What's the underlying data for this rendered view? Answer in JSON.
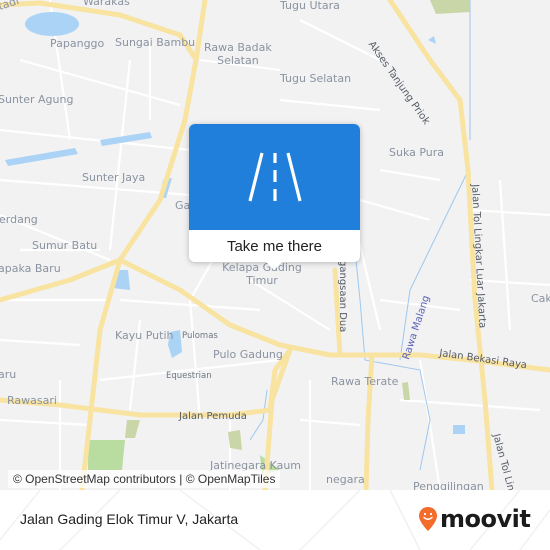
{
  "map": {
    "labels": [
      {
        "id": "warakas",
        "text": "Warakas"
      },
      {
        "id": "papanggo",
        "text": "Papanggo"
      },
      {
        "id": "sungai-bambu",
        "text": "Sungai Bambu"
      },
      {
        "id": "rawa-badak-selatan-1",
        "text": "Rawa Badak"
      },
      {
        "id": "rawa-badak-selatan-2",
        "text": "Selatan"
      },
      {
        "id": "tugu-utara",
        "text": "Tugu Utara"
      },
      {
        "id": "tugu-selatan",
        "text": "Tugu Selatan"
      },
      {
        "id": "sunter-agung",
        "text": "Sunter Agung"
      },
      {
        "id": "sunter-jaya",
        "text": "Sunter Jaya"
      },
      {
        "id": "suka-pura",
        "text": "Suka Pura"
      },
      {
        "id": "serdang",
        "text": "erdang"
      },
      {
        "id": "sumur-batu",
        "text": "Sumur Batu"
      },
      {
        "id": "cempaka-baru",
        "text": "apaka Baru"
      },
      {
        "id": "gading-partial",
        "text": "Ga"
      },
      {
        "id": "kelapa-gading-timur-1",
        "text": "Kelapa Gading"
      },
      {
        "id": "kelapa-gading-timur-2",
        "text": "Timur"
      },
      {
        "id": "kayu-putih",
        "text": "Kayu Putih"
      },
      {
        "id": "pulomas",
        "text": "Pulomas"
      },
      {
        "id": "pulo-gadung",
        "text": "Pulo Gadung"
      },
      {
        "id": "equestrian",
        "text": "Equestrian"
      },
      {
        "id": "rawasari",
        "text": "Rawasari"
      },
      {
        "id": "baru-partial",
        "text": "aru"
      },
      {
        "id": "rawa-terate",
        "text": "Rawa Terate"
      },
      {
        "id": "jatinegara-kaum",
        "text": "Jatinegara Kaum"
      },
      {
        "id": "jatinegara",
        "text": "negara"
      },
      {
        "id": "penggilingan",
        "text": "Penggilingan"
      },
      {
        "id": "cakung-partial",
        "text": "Cak"
      },
      {
        "id": "sunter-partial",
        "text": "tadi"
      }
    ],
    "roads": {
      "akses_tanjung_priok": "Akses Tanjung Priok",
      "jalan_tol_lingkar_luar": "Jalan Tol Lingkar Luar Jakarta",
      "jalan_tol_lingkar_luar_2": "Jalan Tol Lin",
      "jalan_bekasi_raya": "Jalan Bekasi Raya",
      "jalan_pemuda": "Jalan Pemuda",
      "pegangsaan_dua": "gangsaan Dua",
      "rawa_malang": "Rawa Malang"
    },
    "colors": {
      "background": "#f2f2f3",
      "major_road": "#f8e3a1",
      "minor_road": "#ffffff",
      "water": "#aad3f5",
      "park": "#c9d7a8"
    }
  },
  "popup": {
    "icon": "road-icon",
    "cta_label": "Take me there",
    "accent_color": "#1f7fdb"
  },
  "attribution": {
    "text": "© OpenStreetMap contributors | © OpenMapTiles"
  },
  "footer": {
    "location": "Jalan Gading Elok Timur V, Jakarta",
    "brand": "moovit",
    "brand_color": "#f26c2b"
  }
}
